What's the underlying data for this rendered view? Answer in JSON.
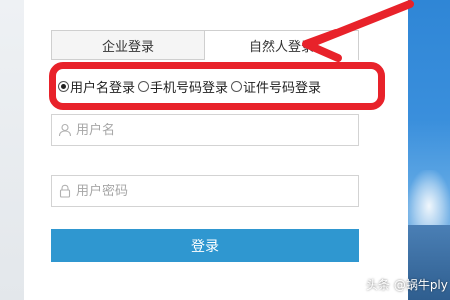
{
  "tabs": [
    {
      "label": "企业登录",
      "active": false
    },
    {
      "label": "自然人登录",
      "active": true
    }
  ],
  "login_type": {
    "selected": "用户名登录",
    "options": [
      "用户名登录",
      "手机号码登录",
      "证件号码登录"
    ]
  },
  "fields": {
    "username_placeholder": "用户名",
    "password_placeholder": "用户密码"
  },
  "login_button": "登录",
  "watermark": "头条 @蜗牛ply",
  "colors": {
    "annotation": "#e8222a",
    "button": "#2f97d0"
  },
  "icons": {
    "user": "user-icon",
    "lock": "lock-icon"
  }
}
